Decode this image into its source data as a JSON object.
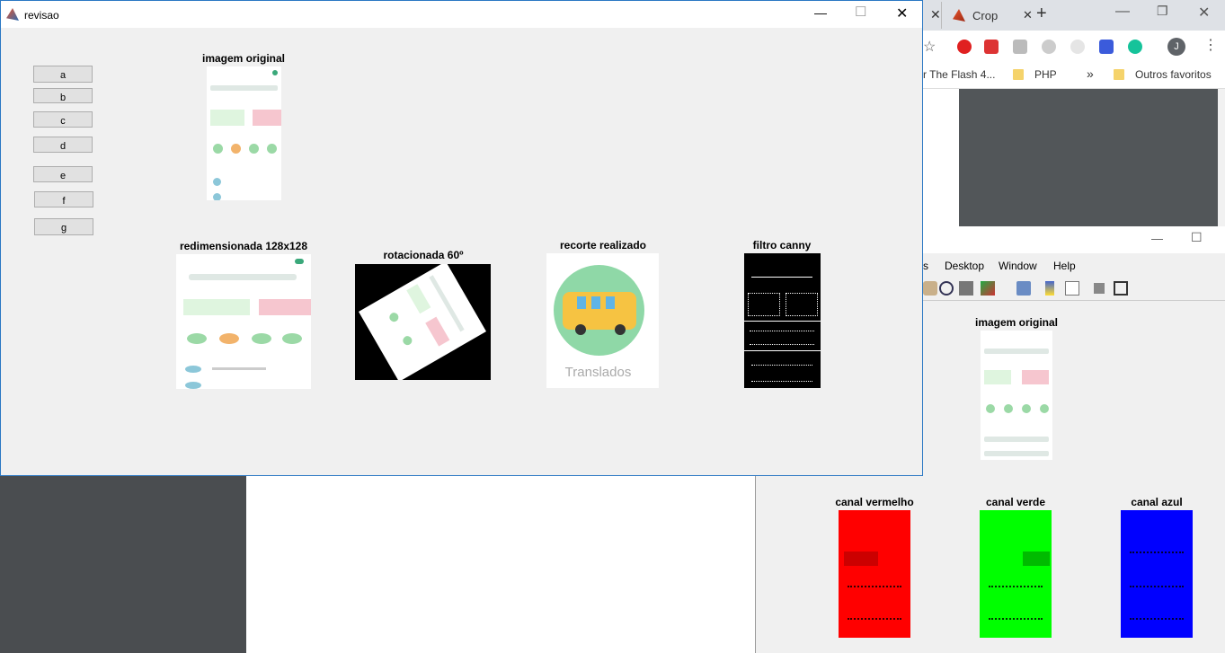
{
  "chrome": {
    "tab_label": "Crop",
    "bookmarks": [
      "r The Flash 4...",
      "PHP",
      "»",
      "Outros favoritos"
    ],
    "profile_initial": "J"
  },
  "figure2": {
    "menu": [
      "s",
      "Desktop",
      "Window",
      "Help"
    ],
    "panels": {
      "original": "imagem original",
      "red": "canal vermelho",
      "green": "canal verde",
      "blue": "canal azul"
    }
  },
  "main_window": {
    "title": "revisao",
    "buttons": [
      "a",
      "b",
      "c",
      "d",
      "e",
      "f",
      "g"
    ],
    "panels": {
      "original": "imagem original",
      "resized": "redimensionada 128x128",
      "rotated": "rotacionada 60º",
      "crop": "recorte realizado",
      "canny": "filtro canny"
    },
    "crop_caption": "Translados"
  },
  "colors": {
    "red_channel": "#ff0000",
    "green_channel": "#00ff00",
    "blue_channel": "#0000ff",
    "window_bg": "#f0f0f0"
  }
}
